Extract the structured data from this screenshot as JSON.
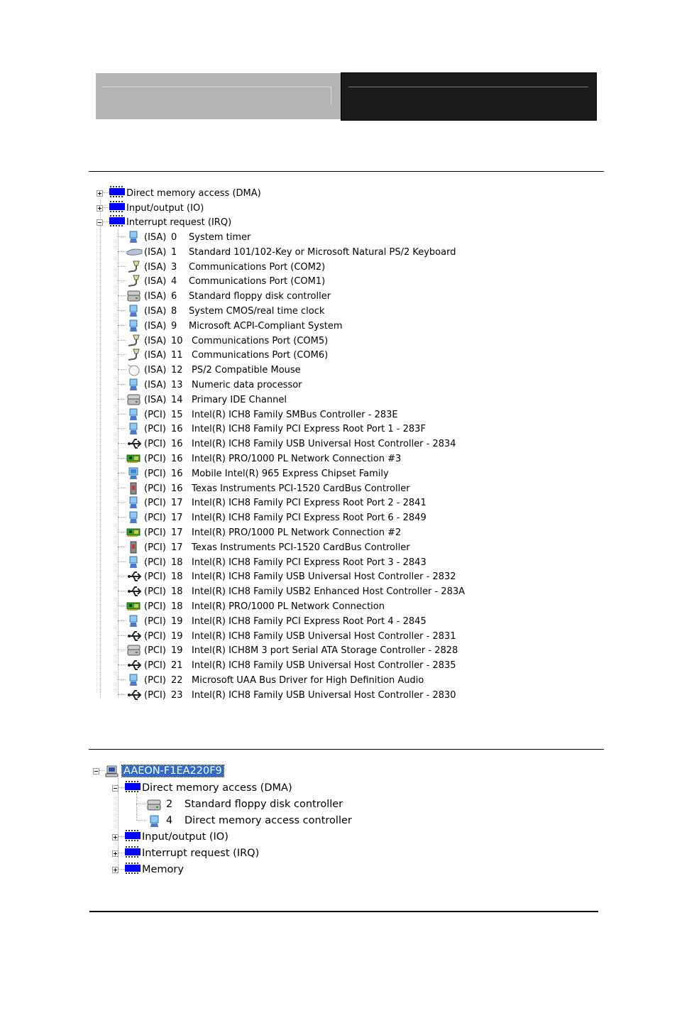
{
  "tree1": {
    "categories": [
      {
        "label": "Direct memory access (DMA)",
        "expanded": false,
        "icon": "chip-icon"
      },
      {
        "label": "Input/output (IO)",
        "expanded": false,
        "icon": "chip-icon"
      },
      {
        "label": "Interrupt request (IRQ)",
        "expanded": true,
        "icon": "chip-icon"
      }
    ],
    "irq_items": [
      {
        "bus": "(ISA)",
        "num": "0",
        "label": "System timer",
        "icon": "system-device-icon"
      },
      {
        "bus": "(ISA)",
        "num": "1",
        "label": "Standard 101/102-Key or Microsoft Natural PS/2 Keyboard",
        "icon": "keyboard-icon"
      },
      {
        "bus": "(ISA)",
        "num": "3",
        "label": "Communications Port (COM2)",
        "icon": "port-icon"
      },
      {
        "bus": "(ISA)",
        "num": "4",
        "label": "Communications Port (COM1)",
        "icon": "port-icon"
      },
      {
        "bus": "(ISA)",
        "num": "6",
        "label": "Standard floppy disk controller",
        "icon": "disk-controller-icon"
      },
      {
        "bus": "(ISA)",
        "num": "8",
        "label": "System CMOS/real time clock",
        "icon": "system-device-icon"
      },
      {
        "bus": "(ISA)",
        "num": "9",
        "label": "Microsoft ACPI-Compliant System",
        "icon": "system-device-icon"
      },
      {
        "bus": "(ISA)",
        "num": "10",
        "label": "Communications Port (COM5)",
        "icon": "port-icon"
      },
      {
        "bus": "(ISA)",
        "num": "11",
        "label": "Communications Port (COM6)",
        "icon": "port-icon"
      },
      {
        "bus": "(ISA)",
        "num": "12",
        "label": "PS/2 Compatible Mouse",
        "icon": "mouse-icon"
      },
      {
        "bus": "(ISA)",
        "num": "13",
        "label": "Numeric data processor",
        "icon": "system-device-icon"
      },
      {
        "bus": "(ISA)",
        "num": "14",
        "label": "Primary IDE Channel",
        "icon": "disk-controller-icon"
      },
      {
        "bus": "(PCI)",
        "num": "15",
        "label": "Intel(R) ICH8 Family SMBus Controller - 283E",
        "icon": "system-device-icon"
      },
      {
        "bus": "(PCI)",
        "num": "16",
        "label": "Intel(R) ICH8 Family PCI Express Root Port 1 - 283F",
        "icon": "system-device-icon"
      },
      {
        "bus": "(PCI)",
        "num": "16",
        "label": "Intel(R) ICH8 Family USB Universal Host Controller - 2834",
        "icon": "usb-icon"
      },
      {
        "bus": "(PCI)",
        "num": "16",
        "label": "Intel(R) PRO/1000 PL Network Connection #3",
        "icon": "network-adapter-icon"
      },
      {
        "bus": "(PCI)",
        "num": "16",
        "label": "Mobile Intel(R) 965 Express Chipset Family",
        "icon": "display-adapter-icon"
      },
      {
        "bus": "(PCI)",
        "num": "16",
        "label": "Texas Instruments PCI-1520 CardBus Controller",
        "icon": "pcmcia-icon"
      },
      {
        "bus": "(PCI)",
        "num": "17",
        "label": "Intel(R) ICH8 Family PCI Express Root Port 2 - 2841",
        "icon": "system-device-icon"
      },
      {
        "bus": "(PCI)",
        "num": "17",
        "label": "Intel(R) ICH8 Family PCI Express Root Port 6 - 2849",
        "icon": "system-device-icon"
      },
      {
        "bus": "(PCI)",
        "num": "17",
        "label": "Intel(R) PRO/1000 PL Network Connection #2",
        "icon": "network-adapter-icon"
      },
      {
        "bus": "(PCI)",
        "num": "17",
        "label": "Texas Instruments PCI-1520 CardBus Controller",
        "icon": "pcmcia-icon"
      },
      {
        "bus": "(PCI)",
        "num": "18",
        "label": "Intel(R) ICH8 Family PCI Express Root Port 3 - 2843",
        "icon": "system-device-icon"
      },
      {
        "bus": "(PCI)",
        "num": "18",
        "label": "Intel(R) ICH8 Family USB Universal Host Controller - 2832",
        "icon": "usb-icon"
      },
      {
        "bus": "(PCI)",
        "num": "18",
        "label": "Intel(R) ICH8 Family USB2 Enhanced Host Controller - 283A",
        "icon": "usb-icon"
      },
      {
        "bus": "(PCI)",
        "num": "18",
        "label": "Intel(R) PRO/1000 PL Network Connection",
        "icon": "network-adapter-icon"
      },
      {
        "bus": "(PCI)",
        "num": "19",
        "label": "Intel(R) ICH8 Family PCI Express Root Port 4 - 2845",
        "icon": "system-device-icon"
      },
      {
        "bus": "(PCI)",
        "num": "19",
        "label": "Intel(R) ICH8 Family USB Universal Host Controller - 2831",
        "icon": "usb-icon"
      },
      {
        "bus": "(PCI)",
        "num": "19",
        "label": "Intel(R) ICH8M 3 port Serial ATA Storage Controller - 2828",
        "icon": "disk-controller-icon"
      },
      {
        "bus": "(PCI)",
        "num": "21",
        "label": "Intel(R) ICH8 Family USB Universal Host Controller - 2835",
        "icon": "usb-icon"
      },
      {
        "bus": "(PCI)",
        "num": "22",
        "label": "Microsoft UAA Bus Driver for High Definition Audio",
        "icon": "system-device-icon"
      },
      {
        "bus": "(PCI)",
        "num": "23",
        "label": "Intel(R) ICH8 Family USB Universal Host Controller - 2830",
        "icon": "usb-icon"
      }
    ]
  },
  "tree2": {
    "root": {
      "label": "AAEON-F1EA220F9",
      "expanded": true,
      "selected": true,
      "icon": "computer-icon"
    },
    "categories": [
      {
        "label": "Direct memory access (DMA)",
        "expanded": true,
        "icon": "chip-icon",
        "children": [
          {
            "num": "2",
            "label": "Standard floppy disk controller",
            "icon": "disk-controller-icon"
          },
          {
            "num": "4",
            "label": "Direct memory access controller",
            "icon": "system-device-icon"
          }
        ]
      },
      {
        "label": "Input/output (IO)",
        "expanded": false,
        "icon": "chip-icon"
      },
      {
        "label": "Interrupt request (IRQ)",
        "expanded": false,
        "icon": "chip-icon"
      },
      {
        "label": "Memory",
        "expanded": false,
        "icon": "chip-icon"
      }
    ]
  }
}
